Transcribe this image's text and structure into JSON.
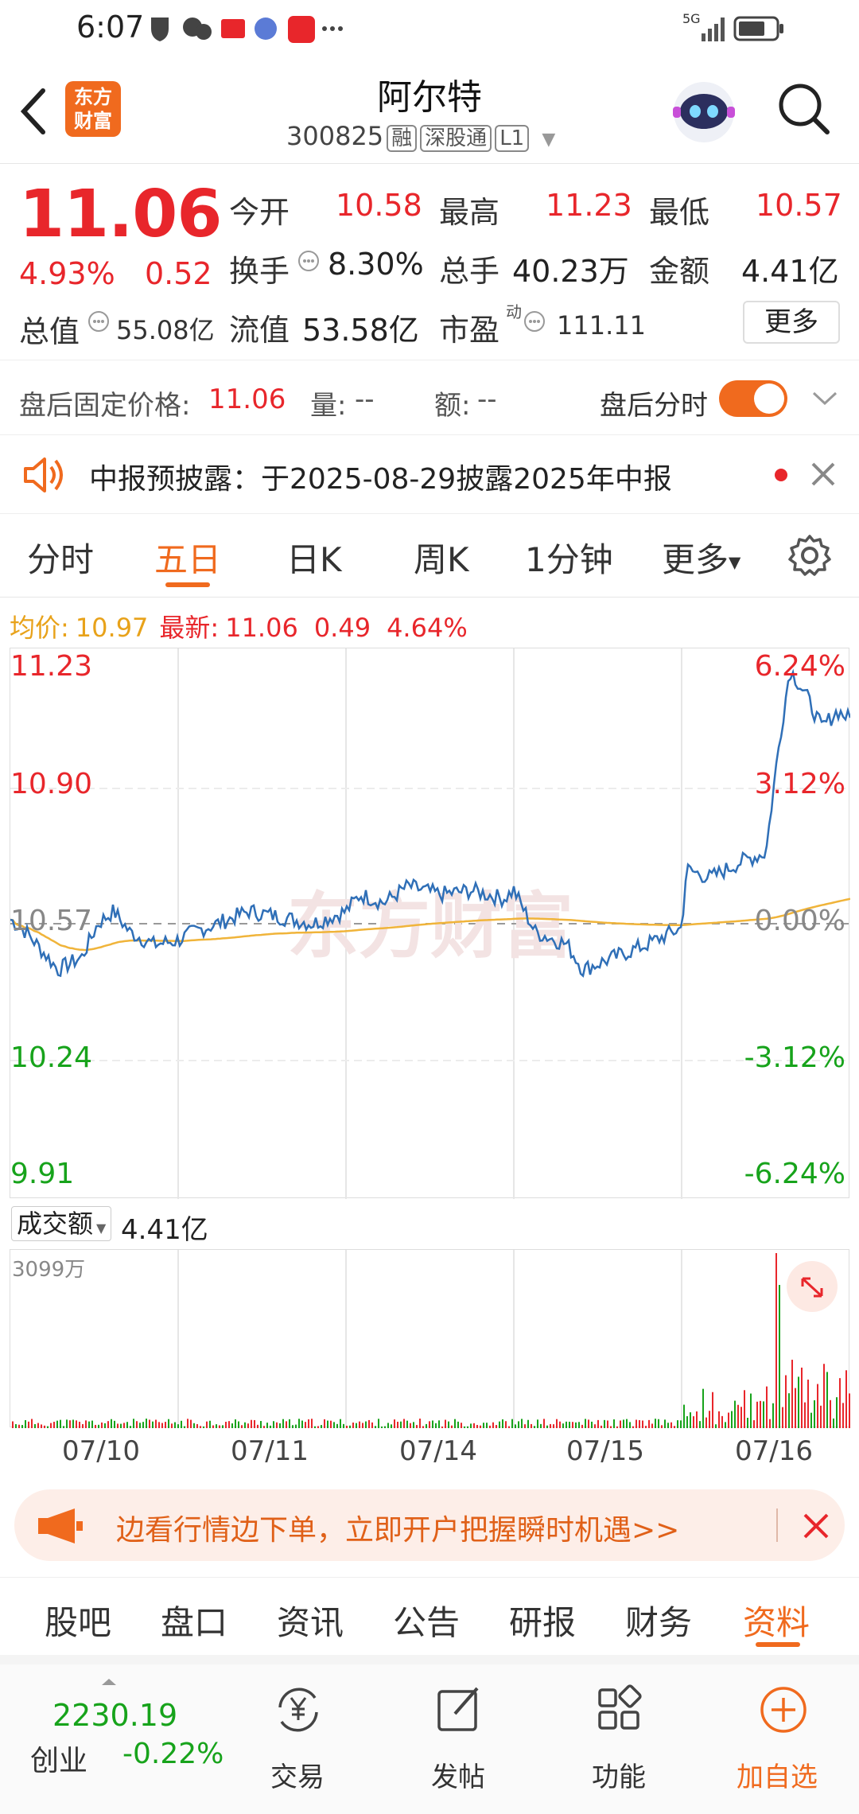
{
  "status_bar": {
    "time": "6:07",
    "network": "5G"
  },
  "header": {
    "logo_line1": "东方",
    "logo_line2": "财富",
    "title": "阿尔特",
    "code": "300825",
    "tags": [
      "融",
      "深股通",
      "L1"
    ]
  },
  "quote": {
    "price": "11.06",
    "change_pct": "4.93%",
    "change": "0.52",
    "open_label": "今开",
    "open": "10.58",
    "high_label": "最高",
    "high": "11.23",
    "low_label": "最低",
    "low": "10.57",
    "turnover_label": "换手",
    "turnover": "8.30%",
    "volume_label": "总手",
    "volume": "40.23万",
    "amount_label": "金额",
    "amount": "4.41亿",
    "mktcap_label": "总值",
    "mktcap": "55.08亿",
    "float_label": "流值",
    "float": "53.58亿",
    "pe_label": "市盈",
    "pe_sup": "动",
    "pe": "111.11",
    "more": "更多"
  },
  "after_hours": {
    "label": "盘后固定价格:",
    "price": "11.06",
    "vol_label": "量:",
    "vol": "--",
    "amt_label": "额:",
    "amt": "--",
    "toggle_label": "盘后分时",
    "toggle_on": true
  },
  "notice": {
    "text": "中报预披露：于2025-08-29披露2025年中报"
  },
  "chart_tabs": [
    "分时",
    "五日",
    "日K",
    "周K",
    "1分钟",
    "更多"
  ],
  "active_chart_tab": "五日",
  "avg_bar": {
    "avg_label": "均价:",
    "avg": "10.97",
    "latest_label": "最新:",
    "latest": "11.06",
    "chg": "0.49",
    "pct": "4.64%"
  },
  "price_axis_left": [
    "11.23",
    "10.90",
    "10.57",
    "10.24",
    "9.91"
  ],
  "price_axis_right": [
    "6.24%",
    "3.12%",
    "0.00%",
    "-3.12%",
    "-6.24%"
  ],
  "watermark": "东方财富",
  "volume_panel": {
    "selector": "成交额",
    "value": "4.41亿",
    "max_label": "3099万"
  },
  "dates": [
    "07/10",
    "07/11",
    "07/14",
    "07/15",
    "07/16"
  ],
  "chart_data": {
    "type": "line",
    "x": [
      "07/10",
      "07/11",
      "07/14",
      "07/15",
      "07/16"
    ],
    "ylim": [
      9.91,
      11.23
    ],
    "series": [],
    "approx_session_close": [
      10.6,
      10.7,
      10.68,
      10.56,
      11.03
    ]
  },
  "colors": {
    "accent": "#e8262b",
    "orange": "#f06a1e",
    "price_line": "#2f6fb7",
    "avg_line": "#f0b43a",
    "down": "#17a31b"
  },
  "banner": {
    "text": "边看行情边下单，立即开户把握瞬时机遇>>"
  },
  "bottom_tabs": [
    "股吧",
    "盘口",
    "资讯",
    "公告",
    "研报",
    "财务",
    "资料"
  ],
  "active_bottom_tab": "资料",
  "index": {
    "value": "2230.19",
    "name": "创业",
    "pct": "-0.22%"
  },
  "nav": [
    {
      "label": "交易",
      "icon": "yen-exchange-icon"
    },
    {
      "label": "发帖",
      "icon": "edit-icon"
    },
    {
      "label": "功能",
      "icon": "grid-icon"
    },
    {
      "label": "加自选",
      "icon": "plus-circle-icon"
    }
  ]
}
